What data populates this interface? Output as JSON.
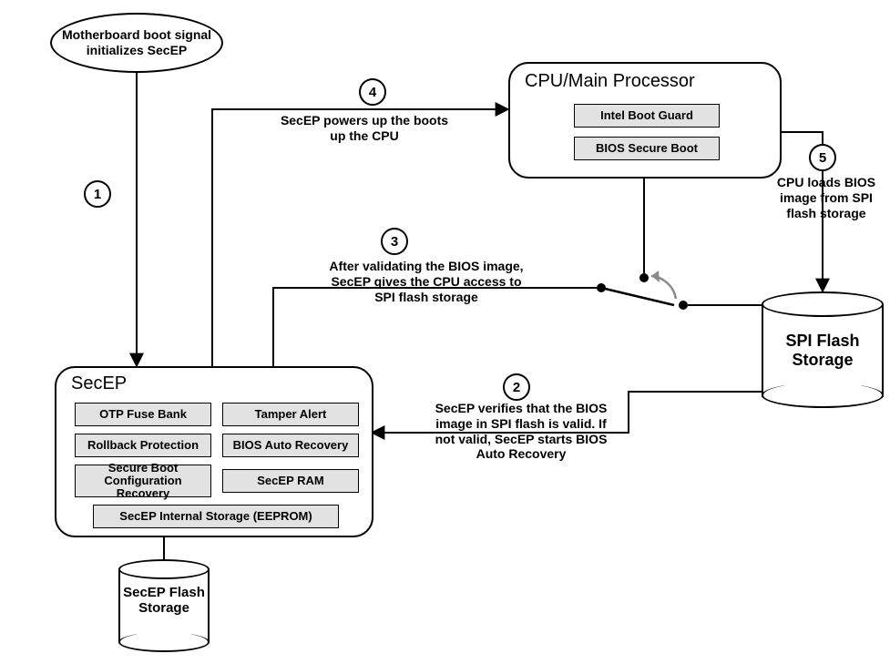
{
  "nodes": {
    "motherboard": "Motherboard boot signal initializes SecEP",
    "cpu": {
      "title": "CPU/Main Processor",
      "chips": [
        "Intel Boot Guard",
        "BIOS Secure Boot"
      ]
    },
    "secep": {
      "title": "SecEP",
      "chips": {
        "otp": "OTP Fuse Bank",
        "tamper": "Tamper Alert",
        "rollback": "Rollback Protection",
        "autorec": "BIOS Auto Recovery",
        "sbconf": "Secure Boot Configuration Recovery",
        "ram": "SecEP RAM",
        "eeprom": "SecEP Internal Storage (EEPROM)"
      }
    },
    "spi_flash": "SPI Flash Storage",
    "secep_flash": "SecEP Flash Storage"
  },
  "steps": {
    "s1": "1",
    "s2": "2",
    "s3": "3",
    "s4": "4",
    "s5": "5"
  },
  "captions": {
    "c4": "SecEP powers up the boots up the CPU",
    "c5": "CPU loads BIOS image from SPI flash storage",
    "c3": "After validating the BIOS image, SecEP gives the CPU access to SPI flash storage",
    "c2": "SecEP verifies that the BIOS image in SPI flash is valid. If not valid, SecEP starts BIOS Auto Recovery"
  }
}
